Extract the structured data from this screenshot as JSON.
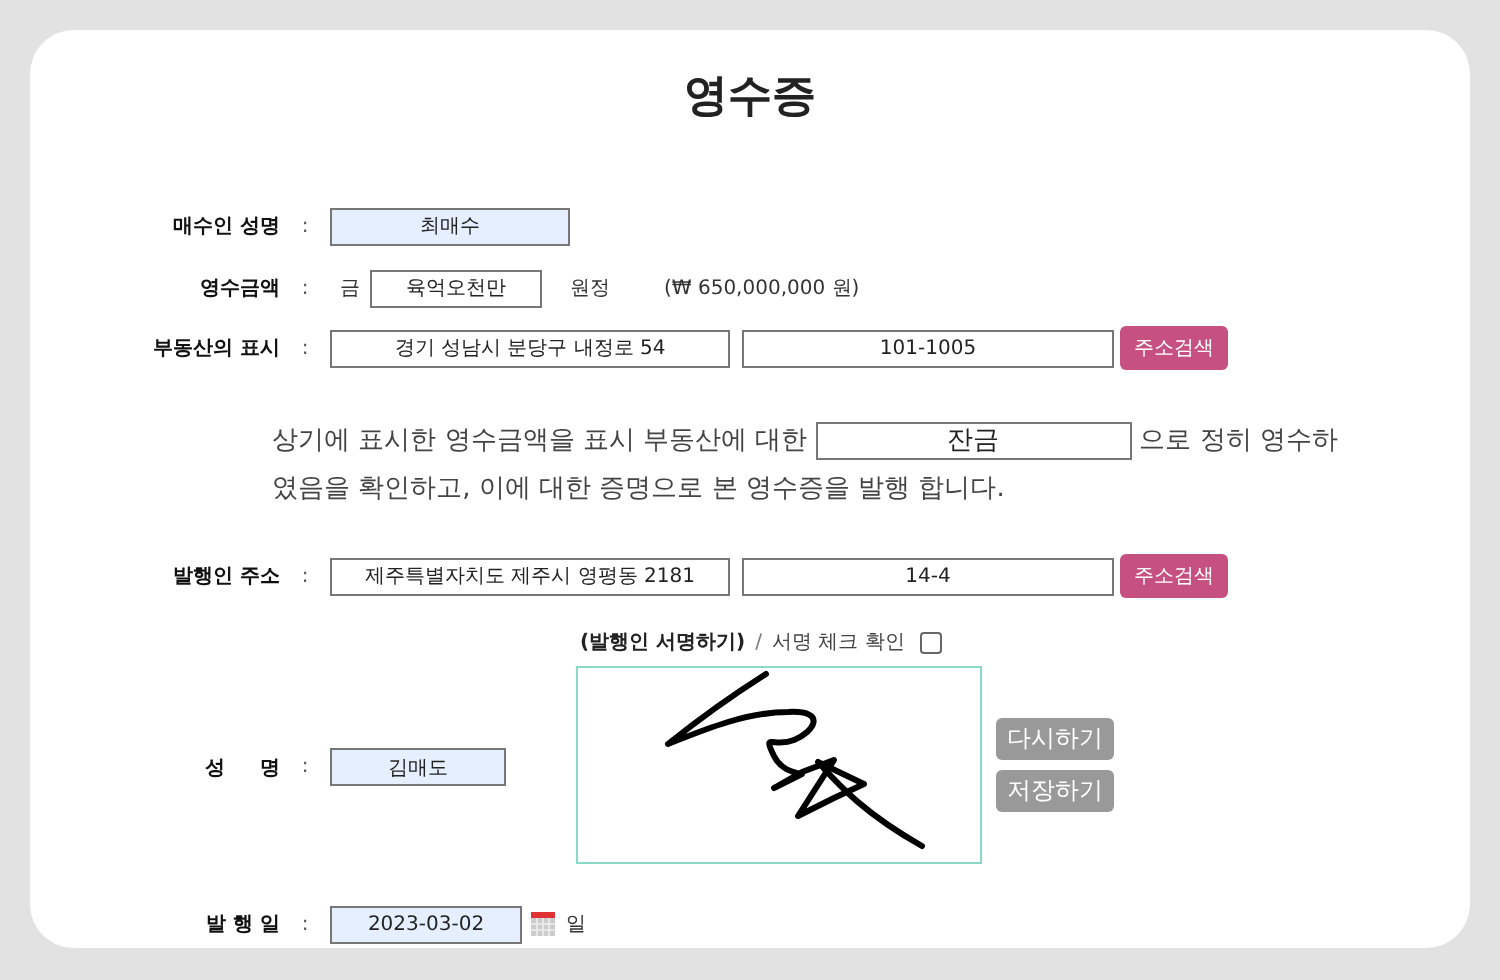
{
  "title": "영수증",
  "buyer": {
    "label": "매수인 성명",
    "colon": ":",
    "value": "최매수"
  },
  "amount": {
    "label": "영수금액",
    "colon": ":",
    "prefix": "금",
    "value": "육억오천만",
    "suffix": "원정",
    "numeric": "(₩ 650,000,000 원)"
  },
  "property": {
    "label": "부동산의 표시",
    "colon": ":",
    "address": "경기 성남시 분당구 내정로 54",
    "detail": "101-1005",
    "button": "주소검색"
  },
  "statement": {
    "before": "상기에 표시한 영수금액을 표시 부동산에 대한",
    "value": "잔금",
    "after": "으로 정히 영수하",
    "line2": "였음을 확인하고, 이에 대한 증명으로 본 영수증을 발행 합니다."
  },
  "issuer_address": {
    "label": "발행인 주소",
    "colon": ":",
    "address": "제주특별자치도 제주시 영평동 2181",
    "detail": "14-4",
    "button": "주소검색"
  },
  "signature": {
    "title": "(발행인 서명하기)",
    "separator": "/",
    "check_label": "서명 체크 확인",
    "checked": false,
    "buttons": [
      "다시하기",
      "저장하기"
    ]
  },
  "issuer_name": {
    "label": "성     명",
    "colon": ":",
    "value": "김매도"
  },
  "issue_date": {
    "label": "발 행 일",
    "colon": ":",
    "value": "2023-03-02",
    "suffix": "일"
  }
}
